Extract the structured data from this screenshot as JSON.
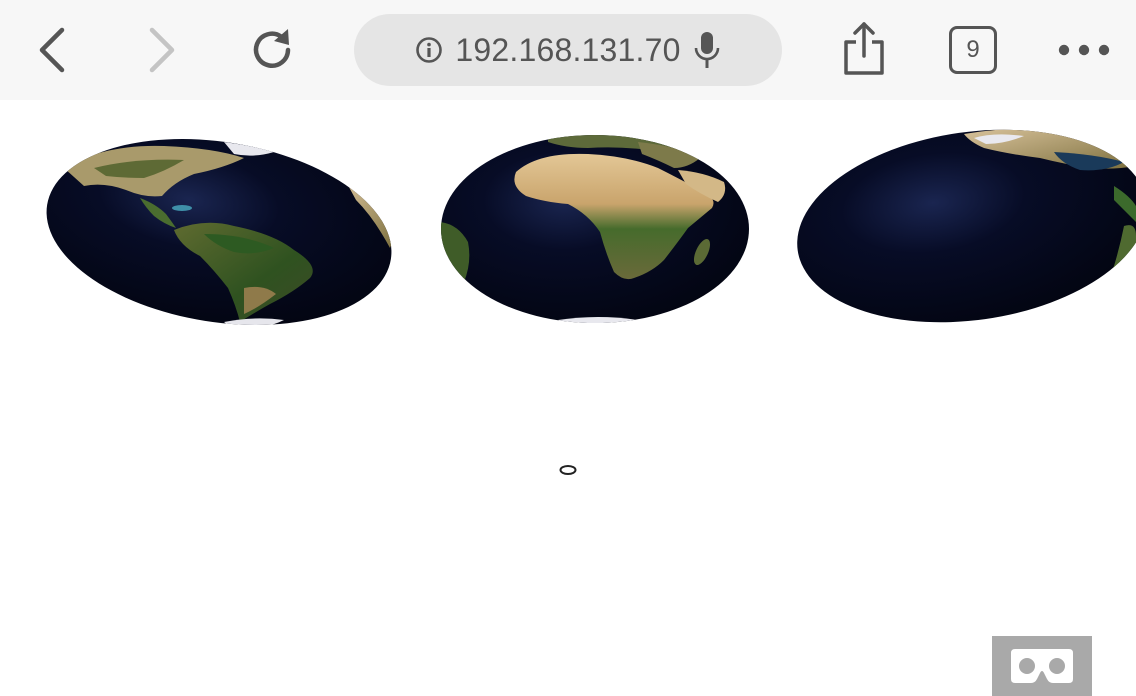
{
  "browser": {
    "url": "192.168.131.70",
    "tab_count": "9",
    "icons": {
      "back": "chevron-left-icon",
      "forward": "chevron-right-icon",
      "reload": "reload-icon",
      "info": "info-icon",
      "mic": "microphone-icon",
      "share": "share-icon",
      "more": "more-dots-icon"
    }
  },
  "scene": {
    "globes": [
      {
        "view": "americas"
      },
      {
        "view": "africa"
      },
      {
        "view": "north-atlantic"
      }
    ],
    "reticle": "gaze-cursor-icon",
    "vr_button_icon": "vr-goggles-icon"
  },
  "colors": {
    "toolbar_bg": "#f7f7f7",
    "urlbar_bg": "#e5e5e5",
    "icon_gray": "#555555",
    "icon_disabled": "#c4c4c4",
    "ocean": "#04071a",
    "vr_button_bg": "#a9a9a9"
  }
}
